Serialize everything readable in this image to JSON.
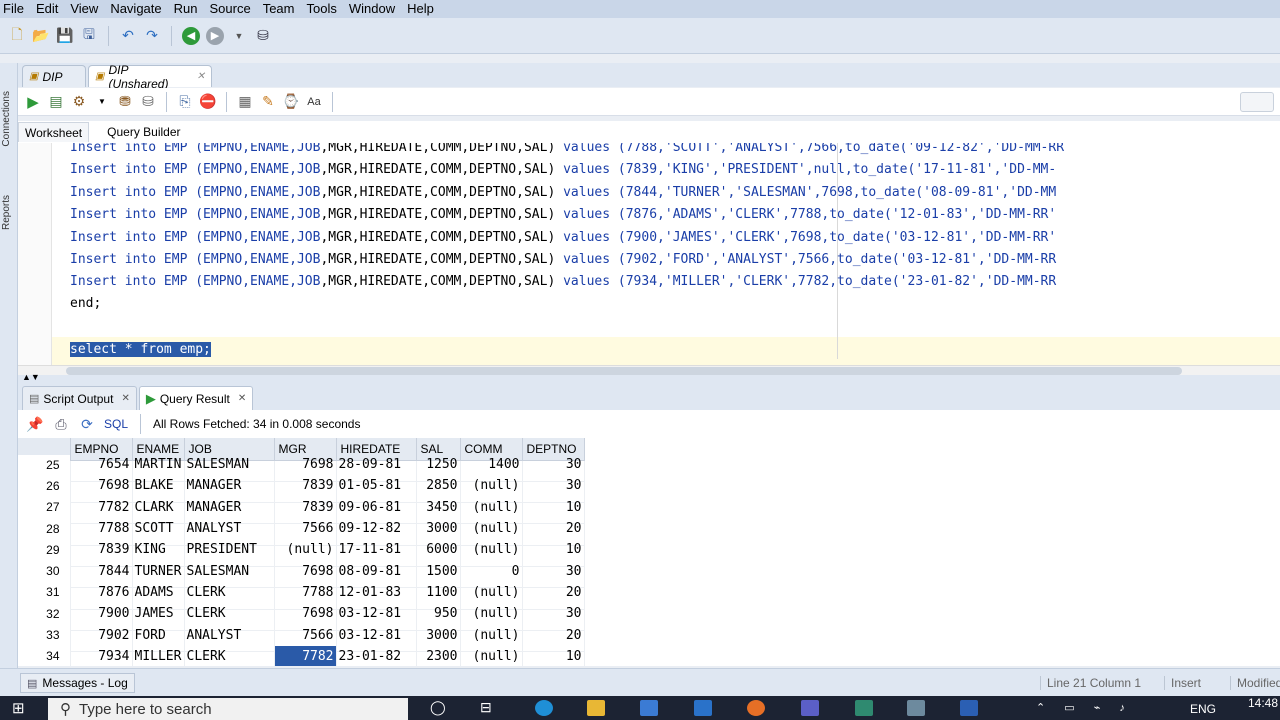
{
  "menu": [
    "File",
    "Edit",
    "View",
    "Navigate",
    "Run",
    "Source",
    "Team",
    "Tools",
    "Window",
    "Help"
  ],
  "doc_tabs": [
    "DIP",
    "DIP (Unshared)"
  ],
  "side_labels": [
    "Connections",
    "Reports"
  ],
  "worksheet_tabs": [
    "Worksheet",
    "Query Builder"
  ],
  "editor": {
    "lines": [
      {
        "pre": "Insert into EMP (EMPNO,ENAME,",
        "job": "JOB",
        "cols": ",MGR,HIREDATE,COMM,DEPTNO,SAL) ",
        "values": "values",
        "rest": " (7788,'SCOTT','ANALYST',7566,to_date('09-12-82','DD-MM-RR"
      },
      {
        "pre": "Insert into EMP (EMPNO,ENAME,",
        "job": "JOB",
        "cols": ",MGR,HIREDATE,COMM,DEPTNO,SAL) ",
        "values": "values",
        "rest": " (7839,'KING','PRESIDENT',null,to_date('17-11-81','DD-MM-"
      },
      {
        "pre": "Insert into EMP (EMPNO,ENAME,",
        "job": "JOB",
        "cols": ",MGR,HIREDATE,COMM,DEPTNO,SAL) ",
        "values": "values",
        "rest": " (7844,'TURNER','SALESMAN',7698,to_date('08-09-81','DD-MM"
      },
      {
        "pre": "Insert into EMP (EMPNO,ENAME,",
        "job": "JOB",
        "cols": ",MGR,HIREDATE,COMM,DEPTNO,SAL) ",
        "values": "values",
        "rest": " (7876,'ADAMS','CLERK',7788,to_date('12-01-83','DD-MM-RR'"
      },
      {
        "pre": "Insert into EMP (EMPNO,ENAME,",
        "job": "JOB",
        "cols": ",MGR,HIREDATE,COMM,DEPTNO,SAL) ",
        "values": "values",
        "rest": " (7900,'JAMES','CLERK',7698,to_date('03-12-81','DD-MM-RR'"
      },
      {
        "pre": "Insert into EMP (EMPNO,ENAME,",
        "job": "JOB",
        "cols": ",MGR,HIREDATE,COMM,DEPTNO,SAL) ",
        "values": "values",
        "rest": " (7902,'FORD','ANALYST',7566,to_date('03-12-81','DD-MM-RR"
      },
      {
        "pre": "Insert into EMP (EMPNO,ENAME,",
        "job": "JOB",
        "cols": ",MGR,HIREDATE,COMM,DEPTNO,SAL) ",
        "values": "values",
        "rest": " (7934,'MILLER','CLERK',7782,to_date('23-01-82','DD-MM-RR"
      }
    ],
    "end_line": "end;",
    "selected_line": "select * from emp;"
  },
  "output_tabs": [
    "Script Output",
    "Query Result"
  ],
  "output_bar": {
    "sql_label": "SQL",
    "status": "All Rows Fetched: 34 in 0.008 seconds"
  },
  "grid": {
    "columns": [
      "EMPNO",
      "ENAME",
      "JOB",
      "MGR",
      "HIREDATE",
      "SAL",
      "COMM",
      "DEPTNO"
    ],
    "rows": [
      [
        "25",
        "7654",
        "MARTIN",
        "SALESMAN",
        "7698",
        "28-09-81",
        "1250",
        "1400",
        "30"
      ],
      [
        "26",
        "7698",
        "BLAKE",
        "MANAGER",
        "7839",
        "01-05-81",
        "2850",
        "(null)",
        "30"
      ],
      [
        "27",
        "7782",
        "CLARK",
        "MANAGER",
        "7839",
        "09-06-81",
        "3450",
        "(null)",
        "10"
      ],
      [
        "28",
        "7788",
        "SCOTT",
        "ANALYST",
        "7566",
        "09-12-82",
        "3000",
        "(null)",
        "20"
      ],
      [
        "29",
        "7839",
        "KING",
        "PRESIDENT",
        "(null)",
        "17-11-81",
        "6000",
        "(null)",
        "10"
      ],
      [
        "30",
        "7844",
        "TURNER",
        "SALESMAN",
        "7698",
        "08-09-81",
        "1500",
        "0",
        "30"
      ],
      [
        "31",
        "7876",
        "ADAMS",
        "CLERK",
        "7788",
        "12-01-83",
        "1100",
        "(null)",
        "20"
      ],
      [
        "32",
        "7900",
        "JAMES",
        "CLERK",
        "7698",
        "03-12-81",
        "950",
        "(null)",
        "30"
      ],
      [
        "33",
        "7902",
        "FORD",
        "ANALYST",
        "7566",
        "03-12-81",
        "3000",
        "(null)",
        "20"
      ],
      [
        "34",
        "7934",
        "MILLER",
        "CLERK",
        "7782",
        "23-01-82",
        "2300",
        "(null)",
        "10"
      ]
    ]
  },
  "status": {
    "messages": "Messages - Log",
    "position": "Line 21 Column 1",
    "mode": "Insert",
    "modified": "Modified"
  },
  "taskbar": {
    "search_placeholder": "Type here to search",
    "lang": "ENG",
    "time": "14:48"
  }
}
